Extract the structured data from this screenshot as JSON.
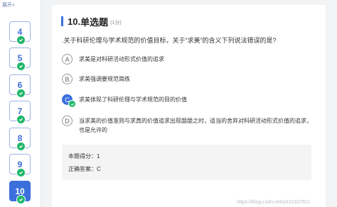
{
  "sidebar": {
    "expand_label": "展开»",
    "items": [
      {
        "label": "4"
      },
      {
        "label": "5"
      },
      {
        "label": "6"
      },
      {
        "label": "7"
      },
      {
        "label": "8"
      },
      {
        "label": "9"
      },
      {
        "label": "10"
      }
    ]
  },
  "question": {
    "number": "10.",
    "type": "单选题",
    "score": "(1分)",
    "text": ".关于科研伦理与学术规范的价值目标，关于“求美”的含义下列说法错误的是?",
    "options": [
      {
        "letter": "A",
        "text": "求美是对科研活动形式价值的追求"
      },
      {
        "letter": "B",
        "text": "求美强调要规范简练"
      },
      {
        "letter": "C",
        "text": "求美体现了科研伦理与学术规范的目的价值"
      },
      {
        "letter": "D",
        "text": "当求美的价值准则与求真的价值追求出现龃龉之时，适当的舍弃对科研活动形式价值的追求，也是允许的"
      }
    ]
  },
  "result": {
    "score_text": "本题得分：1",
    "answer_text": "正确答案：C"
  },
  "colors": {
    "accent": "#3a6fdc",
    "check": "#1fb86a"
  },
  "watermark": "https://blog.csdn.net/u010337911"
}
